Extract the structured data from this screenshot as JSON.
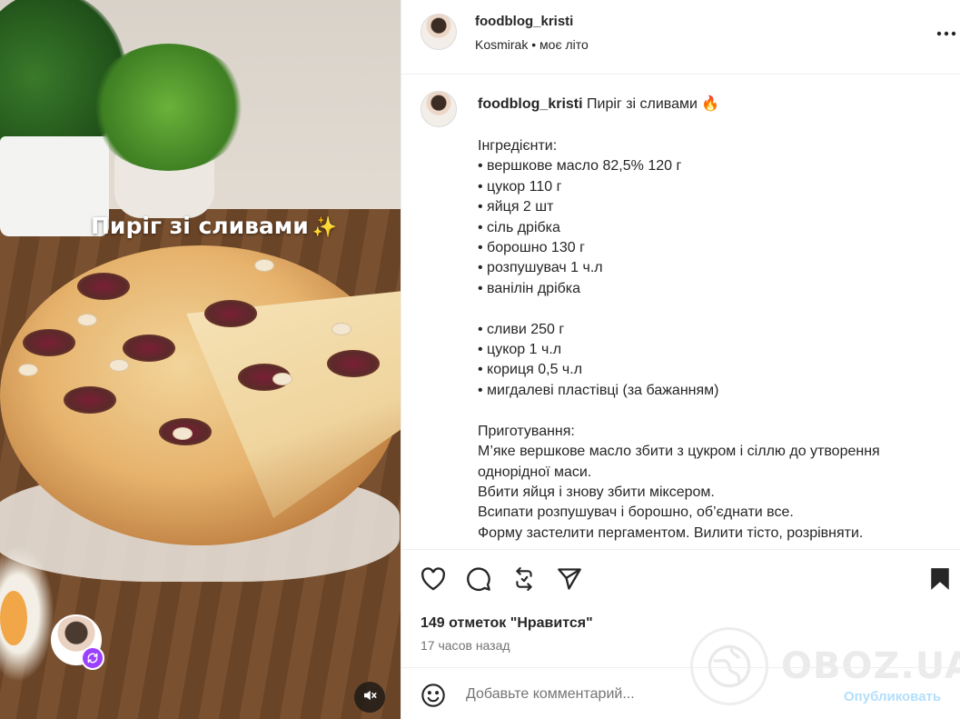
{
  "media": {
    "caption": "Пиріг зі сливами",
    "caption_emoji": "✨",
    "remix_icon": "remix-icon",
    "mute_icon": "speaker-muted-icon"
  },
  "header": {
    "username": "foodblog_kristi",
    "audio_artist": "Kosmirak",
    "separator": "•",
    "audio_title": "моє літо",
    "more_icon": "…"
  },
  "post": {
    "username": "foodblog_kristi",
    "title": "Пиріг зі сливами",
    "title_emoji": "🔥",
    "body": "Інгредієнти:\n• вершкове масло 82,5% 120 г\n• цукор 110 г\n• яйця 2 шт\n• сіль дрібка\n• борошно 130 г\n• розпушувач 1 ч.л\n• ванілін дрібка\n\n• сливи 250 г\n• цукор 1 ч.л\n• кориця 0,5 ч.л\n• мигдалеві пластівці (за бажанням)\n\nПриготування:\nМ’яке вершкове масло збити з цукром і сіллю до утворення однорідної маси.\nВбити яйця і знову збити міксером.\nВсипати розпушувач і борошно, об’єднати все.\nФорму застелити пергаментом. Вилити тісто, розрівняти."
  },
  "actions": {
    "likes": "149 отметок \"Нравится\"",
    "time": "17 часов назад"
  },
  "comment": {
    "placeholder": "Добавьте комментарий...",
    "post_label": "Опубликовать"
  },
  "watermark": {
    "text": "OBOZ.UA"
  },
  "colors": {
    "link_disabled": "#b2dffc",
    "secondary_text": "#737373",
    "remix_badge": "#9b40ff"
  }
}
